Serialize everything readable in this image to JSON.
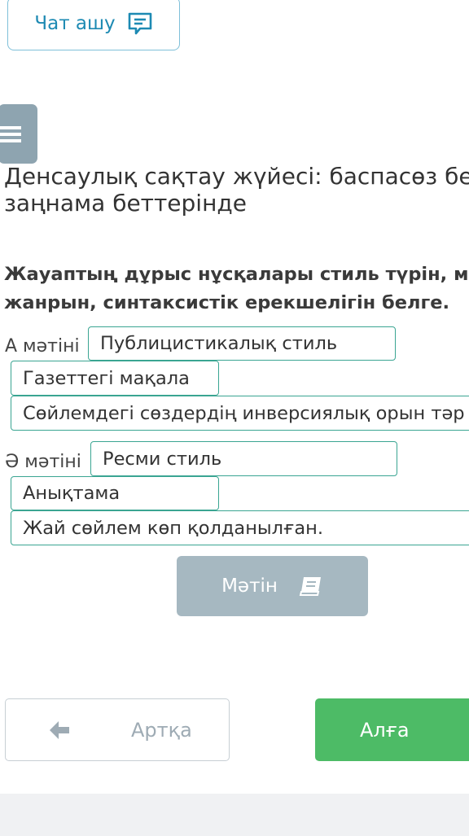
{
  "chat": {
    "label": "Чат ашу",
    "icon": "chat-bubble-icon",
    "color": "#1d8ab3"
  },
  "menu": {
    "icon": "hamburger-menu-icon"
  },
  "lesson": {
    "title_line1": "Денсаулық сақтау жүйесі: баспасөз бе",
    "title_line2": "заңнама беттерінде"
  },
  "question": {
    "instruction_line1": "Жауаптың дұрыс нұсқалары стиль түрін, м",
    "instruction_line2": "жанрын, синтаксистік ерекшелігін белге."
  },
  "answers": [
    {
      "label": "А мәтіні",
      "style": "Публицистикалық стиль",
      "genre": "Газеттегі мақала",
      "syntax": "Сөйлемдегі сөздердің инверсиялық орын тәр"
    },
    {
      "label": "Ә мәтіні",
      "style": "Ресми стиль",
      "genre": "Анықтама",
      "syntax": "Жай сөйлем көп қолданылған."
    }
  ],
  "text_button": {
    "label": "Мәтін",
    "icon": "book-icon"
  },
  "navigation": {
    "back_label": "Артқа",
    "back_icon": "arrow-left-icon",
    "next_label": "Алға"
  },
  "colors": {
    "accent_green": "#4dbb66",
    "box_border": "#3aa592",
    "disabled_gray": "#a6b8c1"
  }
}
